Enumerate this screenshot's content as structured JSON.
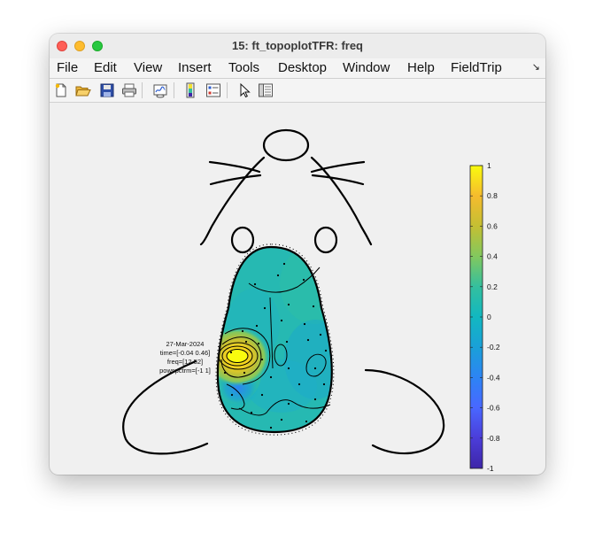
{
  "window": {
    "title": "15: ft_topoplotTFR: freq"
  },
  "menu": {
    "items": [
      "File",
      "Edit",
      "View",
      "Insert",
      "Tools",
      "Desktop",
      "Window",
      "Help",
      "FieldTrip"
    ],
    "overflow_icon": "corner-arrow-icon"
  },
  "toolbar": {
    "icons": [
      "new-figure-icon",
      "open-file-icon",
      "save-icon",
      "print-icon",
      "link-plot-icon",
      "colorbar-icon",
      "legend-icon",
      "edit-plot-icon",
      "property-inspector-icon"
    ]
  },
  "figure": {
    "info": {
      "date": "27-Mar-2024",
      "time": "time=[-0.04 0.46]",
      "freq": "freq=[12 52]",
      "param": "powspctrm=[-1 1]"
    },
    "colorbar": {
      "ticks": [
        "1",
        "0.8",
        "0.6",
        "0.4",
        "0.2",
        "0",
        "-0.2",
        "-0.4",
        "-0.6",
        "-0.8",
        "-1"
      ],
      "colormap": [
        "#f9fb0e",
        "#f5bb2e",
        "#c4bf33",
        "#82c85e",
        "#34bf9e",
        "#12b8c0",
        "#1aa0d8",
        "#2d84f4",
        "#4967ff",
        "#4b3dd9",
        "#3e26a8"
      ],
      "max_color": "#f9fb0e",
      "zero_color": "#24b9b4",
      "min_color": "#3e26a8"
    }
  }
}
